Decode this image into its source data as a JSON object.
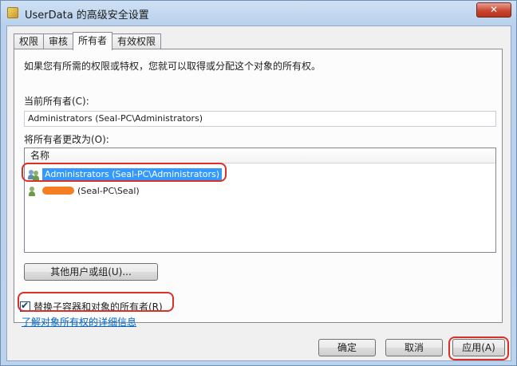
{
  "window": {
    "title": "UserData 的高级安全设置",
    "close_label": "✕"
  },
  "tabs": [
    {
      "label": "权限"
    },
    {
      "label": "审核"
    },
    {
      "label": "所有者"
    },
    {
      "label": "有效权限"
    }
  ],
  "owner_tab": {
    "description": "如果您有所需的权限或特权，您就可以取得或分配这个对象的所有权。",
    "current_owner_label": "当前所有者(C):",
    "current_owner_value": "Administrators (Seal-PC\\Administrators)",
    "change_owner_label": "将所有者更改为(O):",
    "list_header": "名称",
    "list_items": [
      {
        "label": "Administrators (Seal-PC\\Administrators)",
        "selected": true,
        "icon": "user-group-icon"
      },
      {
        "label": "(Seal-PC\\Seal)",
        "selected": false,
        "icon": "user-icon",
        "name_redacted": true
      }
    ],
    "other_users_button": "其他用户或组(U)...",
    "replace_owner_checkbox": {
      "label": "替换子容器和对象的所有者(R)",
      "checked": true
    },
    "learn_more_link": "了解对象所有权的详细信息"
  },
  "footer": {
    "ok": "确定",
    "cancel": "取消",
    "apply": "应用(A)"
  },
  "colors": {
    "selection": "#3399ff",
    "annotation": "#d9302a",
    "link": "#0066cc"
  }
}
